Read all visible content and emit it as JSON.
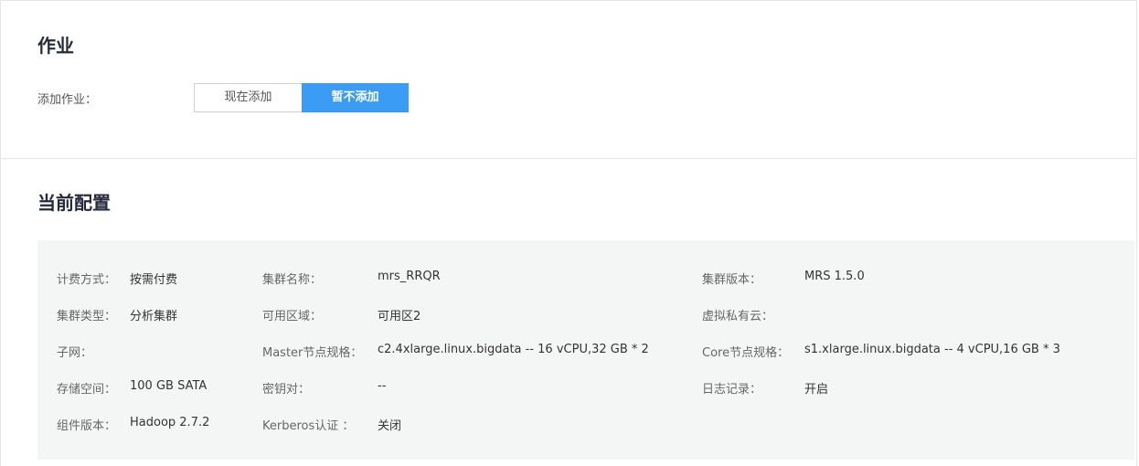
{
  "job": {
    "title": "作业",
    "add_label": "添加作业：",
    "toggle": {
      "now": "现在添加",
      "later": "暂不添加",
      "selected": "暂不添加"
    }
  },
  "config": {
    "title": "当前配置",
    "rows": [
      [
        {
          "label": "计费方式：",
          "value": "按需付费"
        },
        {
          "label": "集群名称：",
          "value": "mrs_RRQR"
        },
        {
          "label": "集群版本：",
          "value": "MRS 1.5.0"
        }
      ],
      [
        {
          "label": "集群类型：",
          "value": "分析集群"
        },
        {
          "label": "可用区域：",
          "value": "可用区2"
        },
        {
          "label": "虚拟私有云：",
          "value": ""
        }
      ],
      [
        {
          "label": "子网：",
          "value": ""
        },
        {
          "label": "Master节点规格：",
          "value": "c2.4xlarge.linux.bigdata -- 16 vCPU,32 GB * 2"
        },
        {
          "label": "Core节点规格：",
          "value": "s1.xlarge.linux.bigdata -- 4 vCPU,16 GB * 3"
        }
      ],
      [
        {
          "label": "存储空间：",
          "value": "100 GB SATA"
        },
        {
          "label": "密钥对：",
          "value": "--"
        },
        {
          "label": "日志记录：",
          "value": "开启"
        }
      ],
      [
        {
          "label": "组件版本：",
          "value": "Hadoop 2.7.2"
        },
        {
          "label": "Kerberos认证 ：",
          "value": "关闭"
        }
      ]
    ]
  }
}
